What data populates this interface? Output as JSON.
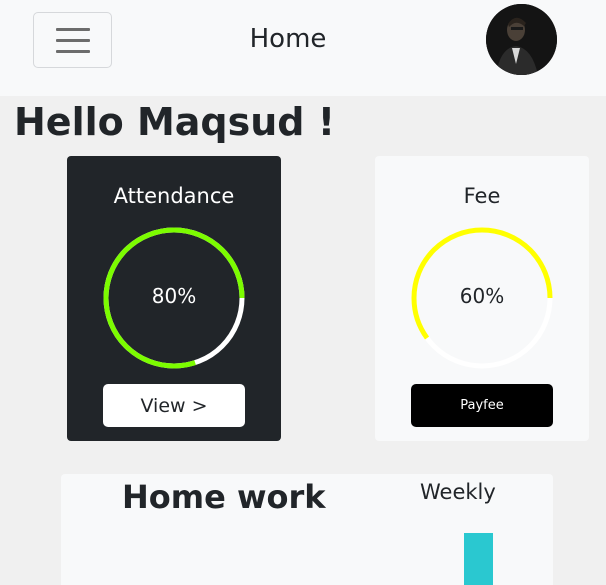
{
  "navbar": {
    "title": "Home",
    "menu_icon": "hamburger-menu-icon",
    "avatar_icon": "user-avatar"
  },
  "greeting": "Hello Maqsud !",
  "attendance": {
    "title": "Attendance",
    "percent_label": "80%",
    "progress": 0.8,
    "ring_color": "#7cfc00",
    "button_label": "View >"
  },
  "fee": {
    "title": "Fee",
    "percent_label": "60%",
    "progress": 0.6,
    "ring_color": "#ffff00",
    "button_label": "Payfee"
  },
  "homework": {
    "title": "Home work",
    "period": "Weekly",
    "bar_color": "#2ac8d0"
  }
}
